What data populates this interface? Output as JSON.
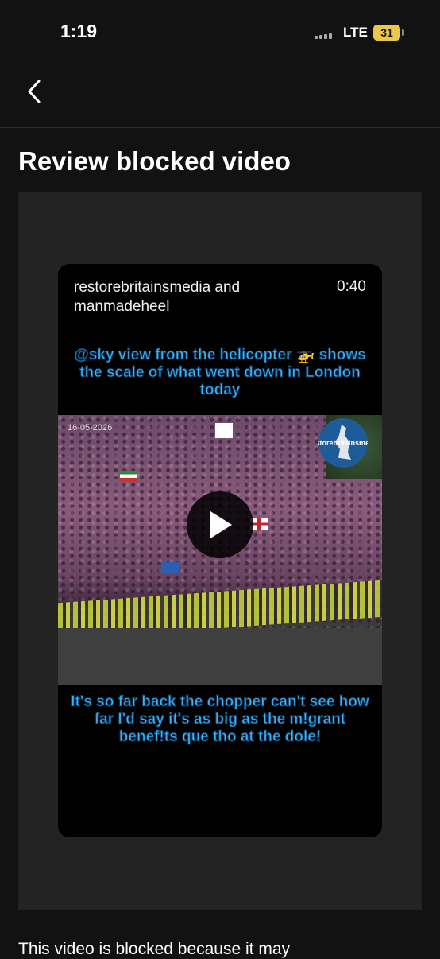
{
  "status_bar": {
    "time": "1:19",
    "network": "LTE",
    "battery": "31"
  },
  "page": {
    "title": "Review blocked video"
  },
  "video": {
    "author": "restorebritainsmedia and manmadeheel",
    "duration": "0:40",
    "caption_top": "@sky view from the helicopter 🚁 shows the scale of what went down in London today",
    "date_stamp": "16-05-2026",
    "watermark": "Restorebritainsmedia",
    "caption_bottom": "It's so far back the chopper can't see how far I'd say it's as big as the m!grant benef!ts que tho at the dole!"
  },
  "notice": "This video is blocked because it may",
  "icons": {
    "back": "chevron-left-icon",
    "play": "play-icon",
    "signal": "signal-bars-icon",
    "battery": "battery-icon"
  },
  "colors": {
    "background": "#121212",
    "panel": "#232323",
    "caption": "#3fb6f5",
    "battery": "#e9c84a"
  }
}
